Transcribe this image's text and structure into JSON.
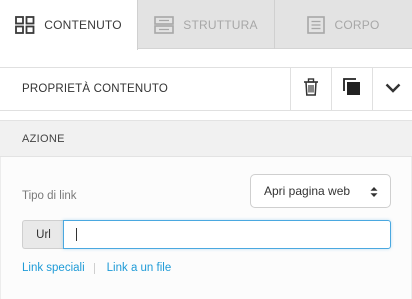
{
  "tabs": [
    {
      "label": "CONTENUTO",
      "icon": "grid-icon",
      "active": true
    },
    {
      "label": "STRUTTURA",
      "icon": "rows-icon",
      "active": false
    },
    {
      "label": "CORPO",
      "icon": "document-icon",
      "active": false
    }
  ],
  "content_properties": {
    "title": "PROPRIETÀ CONTENUTO",
    "actions": [
      "trash-icon",
      "duplicate-icon",
      "chevron-down-icon"
    ]
  },
  "section": {
    "title": "AZIONE"
  },
  "link_type": {
    "label": "Tipo di link",
    "selected": "Apri pagina web"
  },
  "url": {
    "label": "Url",
    "value": ""
  },
  "links": {
    "special": "Link speciali",
    "file": "Link a un file"
  },
  "colors": {
    "accent": "#1e9bd7",
    "input_focus": "#4aa8e0",
    "tab_bar": "#e3e3e3"
  }
}
